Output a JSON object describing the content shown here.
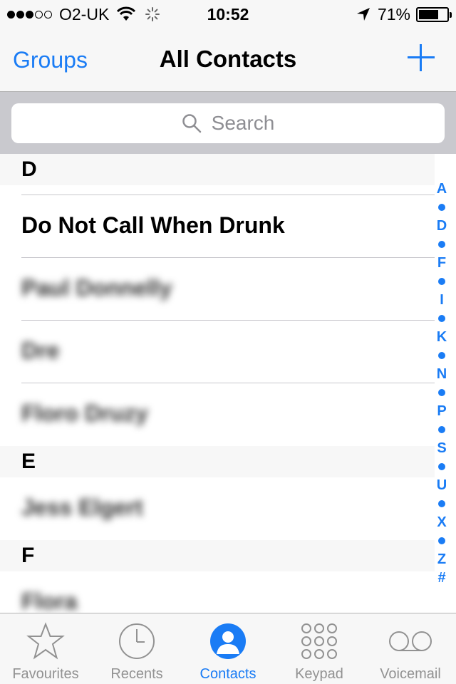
{
  "status_bar": {
    "carrier": "O2-UK",
    "time": "10:52",
    "battery": "71%",
    "battery_level": 0.71,
    "signal_bars": 3,
    "signal_total": 5
  },
  "nav": {
    "left_button": "Groups",
    "title": "All Contacts",
    "add_icon": "plus-icon"
  },
  "search": {
    "placeholder": "Search",
    "icon": "search-icon"
  },
  "sections": [
    {
      "letter": "D",
      "contacts": [
        {
          "name": "Do Not Call When Drunk",
          "blurred": false
        },
        {
          "name": "Paul Donnelly",
          "blurred": true
        },
        {
          "name": "Dre",
          "blurred": true
        },
        {
          "name": "Floro Druzy",
          "blurred": true
        }
      ]
    },
    {
      "letter": "E",
      "contacts": [
        {
          "name": "Jess Elgert",
          "blurred": true
        }
      ]
    },
    {
      "letter": "F",
      "contacts": [
        {
          "name": "Flora",
          "blurred": true
        }
      ]
    }
  ],
  "index": [
    "A",
    "D",
    "F",
    "I",
    "K",
    "N",
    "P",
    "S",
    "U",
    "X",
    "Z",
    "#"
  ],
  "tabs": [
    {
      "label": "Favourites",
      "icon": "star-icon",
      "active": false
    },
    {
      "label": "Recents",
      "icon": "clock-icon",
      "active": false
    },
    {
      "label": "Contacts",
      "icon": "person-icon",
      "active": true
    },
    {
      "label": "Keypad",
      "icon": "keypad-icon",
      "active": false
    },
    {
      "label": "Voicemail",
      "icon": "voicemail-icon",
      "active": false
    }
  ],
  "colors": {
    "accent": "#1a7cf5",
    "inactive": "#929292"
  }
}
